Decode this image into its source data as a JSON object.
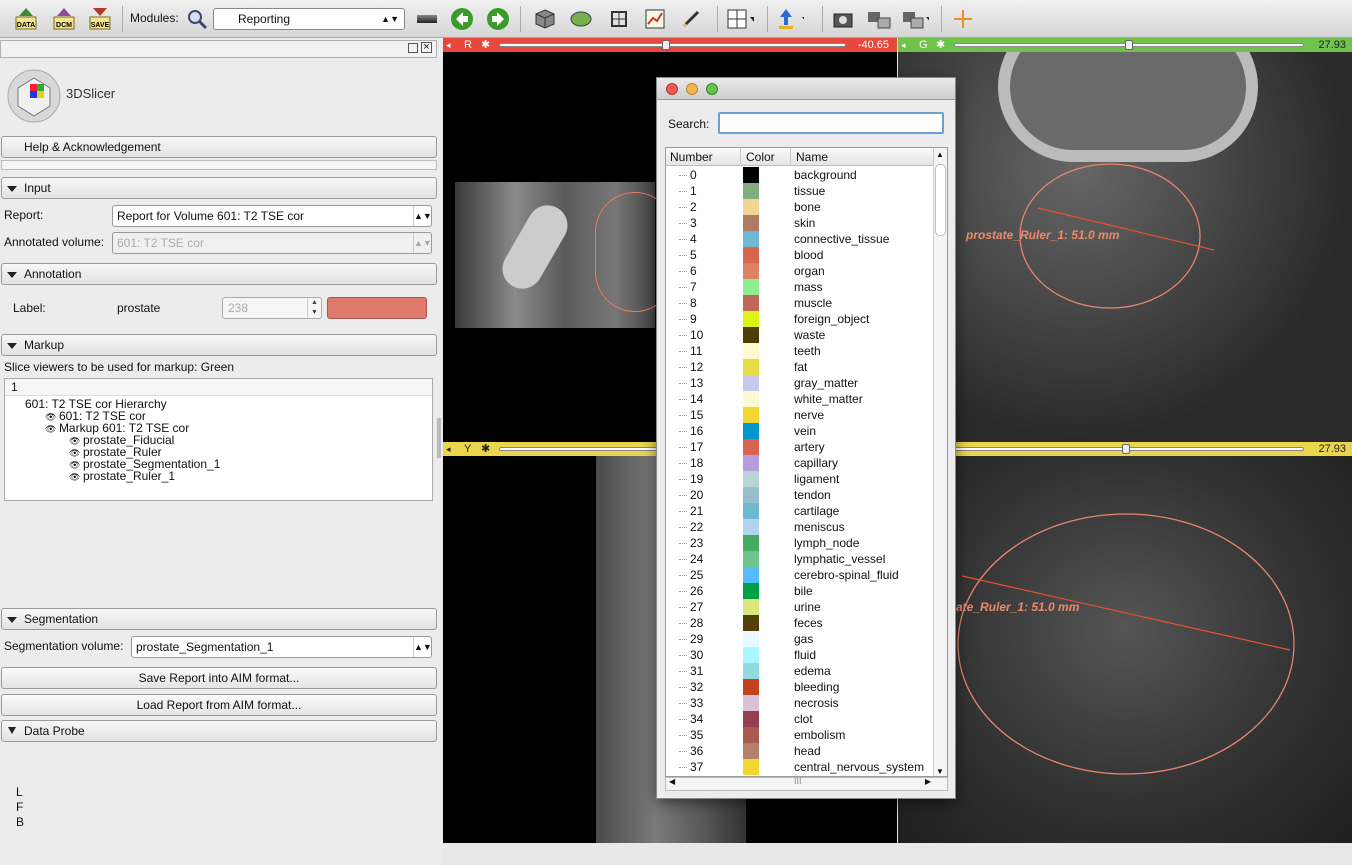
{
  "toolbar": {
    "data_label": "DATA",
    "dcm_label": "DCM",
    "save_label": "SAVE",
    "modules_label": "Modules:",
    "module_selected": "Reporting"
  },
  "panel": {
    "logo": "3DSlicer",
    "help_section": "Help & Acknowledgement",
    "input_section": "Input",
    "report_label": "Report:",
    "report_value": "Report for Volume 601: T2 TSE cor",
    "annotated_label": "Annotated volume:",
    "annotated_value": "601: T2 TSE cor",
    "annotation_section": "Annotation",
    "label_label": "Label:",
    "label_name": "prostate",
    "label_value": "238",
    "label_color": "#e07a6c",
    "markup_section": "Markup",
    "slice_text": "Slice viewers to be used for markup: Green",
    "tree_header": "1",
    "tree": [
      "601: T2 TSE cor Hierarchy",
      "601: T2 TSE cor",
      "Markup 601: T2 TSE cor",
      "prostate_Fiducial",
      "prostate_Ruler",
      "prostate_Segmentation_1",
      "prostate_Ruler_1"
    ],
    "segmentation_section": "Segmentation",
    "seg_label": "Segmentation volume:",
    "seg_value": "prostate_Segmentation_1",
    "save_aim": "Save Report into AIM format...",
    "load_aim": "Load Report from AIM format...",
    "probe_section": "Data Probe",
    "orient": [
      "L",
      "F",
      "B"
    ]
  },
  "views": {
    "red": {
      "label": "R",
      "value": "-40.65",
      "slider": 0.48
    },
    "green": {
      "label": "G",
      "value": "27.93",
      "slider": 0.5
    },
    "yellow": {
      "label": "Y",
      "value": "27.93",
      "slider": 0.78
    },
    "ruler_text_green": "prostate_Ruler_1: 51.0  mm",
    "ruler_text_yellow": "ate_Ruler_1: 51.0  mm"
  },
  "dialog": {
    "search_label": "Search:",
    "col_number": "Number",
    "col_color": "Color",
    "col_name": "Name",
    "rows": [
      {
        "n": "0",
        "name": "background",
        "c": "#000000"
      },
      {
        "n": "1",
        "name": "tissue",
        "c": "#80ae80"
      },
      {
        "n": "2",
        "name": "bone",
        "c": "#f1d691"
      },
      {
        "n": "3",
        "name": "skin",
        "c": "#b17a65"
      },
      {
        "n": "4",
        "name": "connective_tissue",
        "c": "#6fb8d2"
      },
      {
        "n": "5",
        "name": "blood",
        "c": "#d8654f"
      },
      {
        "n": "6",
        "name": "organ",
        "c": "#dd8265"
      },
      {
        "n": "7",
        "name": "mass",
        "c": "#90ee90"
      },
      {
        "n": "8",
        "name": "muscle",
        "c": "#c06858"
      },
      {
        "n": "9",
        "name": "foreign_object",
        "c": "#dcf514"
      },
      {
        "n": "10",
        "name": "waste",
        "c": "#4e3f00"
      },
      {
        "n": "11",
        "name": "teeth",
        "c": "#ffface"
      },
      {
        "n": "12",
        "name": "fat",
        "c": "#e6dc46"
      },
      {
        "n": "13",
        "name": "gray_matter",
        "c": "#c8c8eb"
      },
      {
        "n": "14",
        "name": "white_matter",
        "c": "#fafad2"
      },
      {
        "n": "15",
        "name": "nerve",
        "c": "#f4d631"
      },
      {
        "n": "16",
        "name": "vein",
        "c": "#0097ce"
      },
      {
        "n": "17",
        "name": "artery",
        "c": "#d8654f"
      },
      {
        "n": "18",
        "name": "capillary",
        "c": "#b79cdc"
      },
      {
        "n": "19",
        "name": "ligament",
        "c": "#b7d6d3"
      },
      {
        "n": "20",
        "name": "tendon",
        "c": "#98bdcf"
      },
      {
        "n": "21",
        "name": "cartilage",
        "c": "#6fb8d2"
      },
      {
        "n": "22",
        "name": "meniscus",
        "c": "#b2d4f2"
      },
      {
        "n": "23",
        "name": "lymph_node",
        "c": "#44ac64"
      },
      {
        "n": "24",
        "name": "lymphatic_vessel",
        "c": "#6fc48e"
      },
      {
        "n": "25",
        "name": "cerebro-spinal_fluid",
        "c": "#55bcff"
      },
      {
        "n": "26",
        "name": "bile",
        "c": "#00a047"
      },
      {
        "n": "27",
        "name": "urine",
        "c": "#d8e87c"
      },
      {
        "n": "28",
        "name": "feces",
        "c": "#553f08"
      },
      {
        "n": "29",
        "name": "gas",
        "c": "#e6fbff"
      },
      {
        "n": "30",
        "name": "fluid",
        "c": "#a6f8ff"
      },
      {
        "n": "31",
        "name": "edema",
        "c": "#8edcdc"
      },
      {
        "n": "32",
        "name": "bleeding",
        "c": "#c5401e"
      },
      {
        "n": "33",
        "name": "necrosis",
        "c": "#dcc0d8"
      },
      {
        "n": "34",
        "name": "clot",
        "c": "#963d4f"
      },
      {
        "n": "35",
        "name": "embolism",
        "c": "#aa5a4e"
      },
      {
        "n": "36",
        "name": "head",
        "c": "#b2806c"
      },
      {
        "n": "37",
        "name": "central_nervous_system",
        "c": "#f4d631"
      }
    ]
  }
}
